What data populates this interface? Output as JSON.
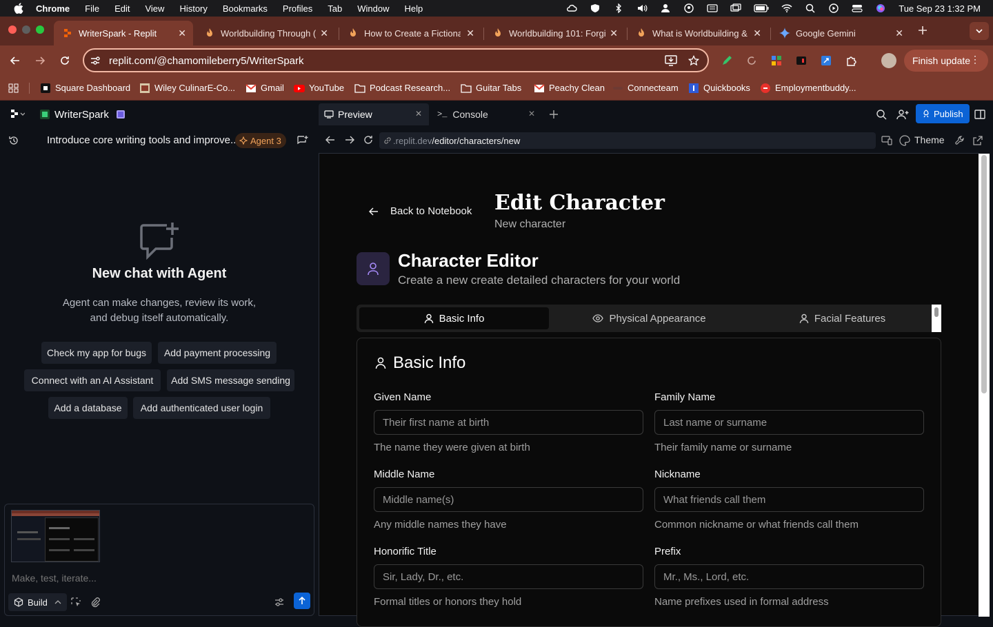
{
  "menubar": {
    "app": "Chrome",
    "items": [
      "File",
      "Edit",
      "View",
      "History",
      "Bookmarks",
      "Profiles",
      "Tab",
      "Window",
      "Help"
    ],
    "clock": "Tue Sep 23  1:32 PM"
  },
  "tabs": [
    {
      "title": "WriterSpark - Replit",
      "active": true
    },
    {
      "title": "Worldbuilding Through (",
      "active": false
    },
    {
      "title": "How to Create a Fictiona",
      "active": false
    },
    {
      "title": "Worldbuilding 101: Forgi",
      "active": false
    },
    {
      "title": "What is Worldbuilding &",
      "active": false
    },
    {
      "title": "Google Gemini",
      "active": false
    }
  ],
  "toolbar": {
    "url": "replit.com/@chamomileberry5/WriterSpark",
    "finish_update": "Finish update"
  },
  "bookmarks": [
    "Square Dashboard",
    "Wiley CulinarE-Co...",
    "Gmail",
    "YouTube",
    "Podcast Research...",
    "Guitar Tabs",
    "Peachy Clean",
    "Connecteam",
    "Quickbooks",
    "Employmentbuddy..."
  ],
  "replit": {
    "project": "WriterSpark",
    "chat_title": "Introduce core writing tools and improve...",
    "agent_badge": "Agent 3",
    "new_chat_title": "New chat with Agent",
    "new_chat_desc": "Agent can make changes, review its work, and debug itself automatically.",
    "suggestions": [
      "Check my app for bugs",
      "Add payment processing",
      "Connect with an AI Assistant",
      "Add SMS message sending",
      "Add a database",
      "Add authenticated user login"
    ],
    "composer_placeholder": "Make, test, iterate...",
    "build_label": "Build",
    "pane_tabs": [
      "Preview",
      "Console"
    ],
    "publish": "Publish",
    "preview_url_domain": ".replit.dev",
    "preview_url_path": "/editor/characters/new",
    "theme_label": "Theme"
  },
  "app": {
    "back_link": "Back to Notebook",
    "page_title": "Edit Character",
    "page_subtitle": "New character",
    "editor_title": "Character Editor",
    "editor_subtitle": "Create a new create detailed characters for your world",
    "tabs": [
      "Basic Info",
      "Physical Appearance",
      "Facial Features"
    ],
    "section_title": "Basic Info",
    "fields": [
      {
        "label": "Given Name",
        "placeholder": "Their first name at birth",
        "help": "The name they were given at birth"
      },
      {
        "label": "Family Name",
        "placeholder": "Last name or surname",
        "help": "Their family name or surname"
      },
      {
        "label": "Middle Name",
        "placeholder": "Middle name(s)",
        "help": "Any middle names they have"
      },
      {
        "label": "Nickname",
        "placeholder": "What friends call them",
        "help": "Common nickname or what friends call them"
      },
      {
        "label": "Honorific Title",
        "placeholder": "Sir, Lady, Dr., etc.",
        "help": "Formal titles or honors they hold"
      },
      {
        "label": "Prefix",
        "placeholder": "Mr., Ms., Lord, etc.",
        "help": "Name prefixes used in formal address"
      }
    ]
  },
  "colors": {
    "tabbar": "#5b2a22",
    "toolbar": "#7a3a2d",
    "replit_bg": "#0e1117",
    "publish": "#0b63d6",
    "agent_badge": "#f2a35a",
    "editor_accent": "#a78bfa"
  }
}
